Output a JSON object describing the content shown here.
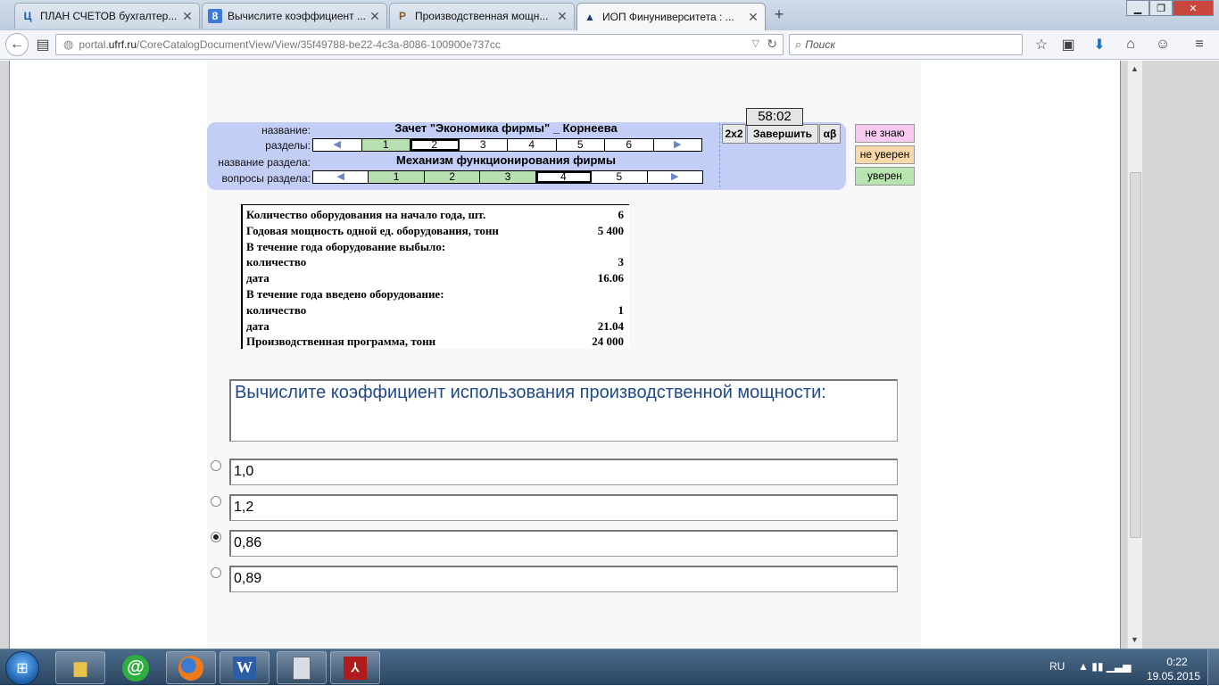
{
  "browser": {
    "tabs": [
      {
        "icon": "Ц",
        "title": "ПЛАН СЧЕТОВ бухгалтер..."
      },
      {
        "icon": "8",
        "title": "Вычислите коэффициент ..."
      },
      {
        "icon": "P",
        "title": "Производственная мощн..."
      },
      {
        "icon": "▲",
        "title": "ИОП Финуниверситета : ..."
      }
    ],
    "new_tab": "+",
    "url_prefix": "portal.",
    "url_domain": "ufrf.ru",
    "url_path": "/CoreCatalogDocumentView/View/35f49788-be22-4c3a-8086-100900e737cc",
    "search_placeholder": "Поиск"
  },
  "test": {
    "labels": {
      "name": "название:",
      "sections": "разделы:",
      "section_name": "название раздела:",
      "section_questions": "вопросы раздела:"
    },
    "title": "Зачет \"Экономика фирмы\" _ Корнеева",
    "section_title": "Механизм функционирования  фирмы",
    "sections": [
      "1",
      "2",
      "3",
      "4",
      "5",
      "6"
    ],
    "questions": [
      "1",
      "2",
      "3",
      "4",
      "5"
    ],
    "buttons": {
      "grid": "2x2",
      "finish": "Завершить",
      "alpha": "αβ"
    },
    "timer": "58:02",
    "confidence": {
      "dont_know": "не знаю",
      "unsure": "не уверен",
      "sure": "уверен"
    },
    "confidence_colors": {
      "dont_know": "#f8c8f0",
      "unsure": "#f8d8a8",
      "sure": "#b8e4b0"
    }
  },
  "table": [
    {
      "label": "Количество оборудования на начало года, шт.",
      "value": "6"
    },
    {
      "label": "Годовая мощность одной ед. оборудования, тонн",
      "value": "5 400"
    },
    {
      "label": "В течение года оборудование выбыло:",
      "value": ""
    },
    {
      "label": "количество",
      "value": "3"
    },
    {
      "label": "дата",
      "value": "16.06"
    },
    {
      "label": "В течение года введено оборудование:",
      "value": ""
    },
    {
      "label": "количество",
      "value": "1"
    },
    {
      "label": "дата",
      "value": "21.04"
    },
    {
      "label": "Производственная программа, тонн",
      "value": "24 000"
    }
  ],
  "question": "Вычислите коэффициент использования производственной мощности:",
  "options": [
    "1,0",
    "1,2",
    "0,86",
    "0,89"
  ],
  "taskbar": {
    "lang": "RU",
    "time": "0:22",
    "date": "19.05.2015"
  }
}
